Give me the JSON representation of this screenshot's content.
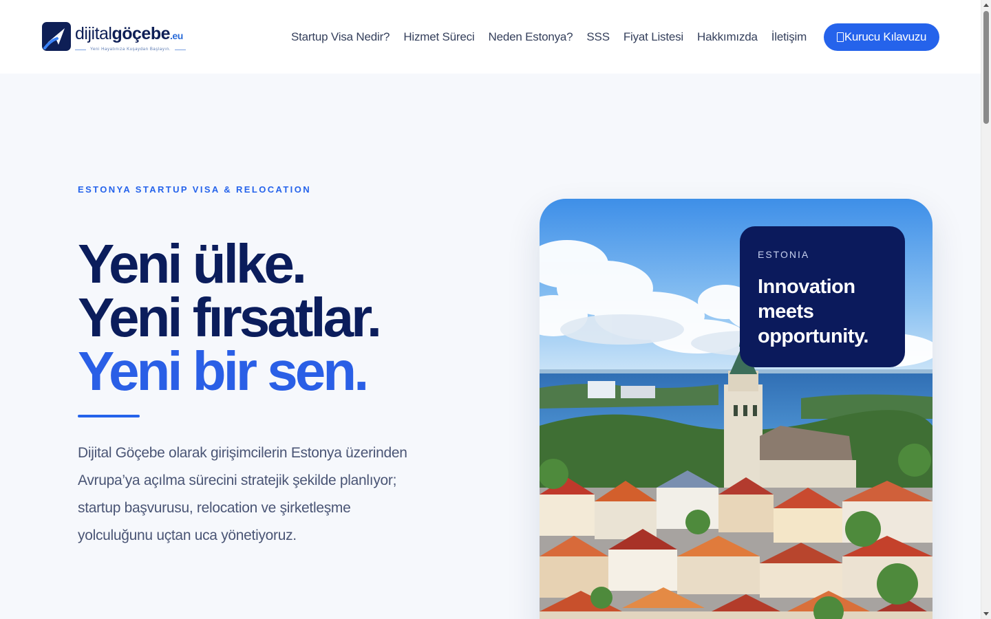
{
  "header": {
    "logo": {
      "word_regular": "dijital",
      "word_bold": "göçebe",
      "word_tld": ".eu",
      "tagline": "Yeni Hayatınıza Kuşaydan Başlayın."
    },
    "nav": [
      {
        "label": "Startup Visa Nedir?"
      },
      {
        "label": "Hizmet Süreci"
      },
      {
        "label": "Neden Estonya?"
      },
      {
        "label": "SSS"
      },
      {
        "label": "Fiyat Listesi"
      },
      {
        "label": "Hakkımızda"
      },
      {
        "label": "İletişim"
      }
    ],
    "cta": {
      "label": "Kurucu Kılavuzu",
      "icon": "book-icon"
    }
  },
  "hero": {
    "eyebrow": "ESTONYA STARTUP VISA & RELOCATION",
    "headline": [
      "Yeni ülke.",
      "Yeni fırsatlar.",
      "Yeni bir sen."
    ],
    "description": "Dijital Göçebe olarak girişimcilerin Estonya üzerinden Avrupa’ya açılma sürecini stratejik şekilde planlıyor; startup başvurusu, relocation ve şirketleşme yolculuğunu uçtan uca yönetiyoruz."
  },
  "photo_badge": {
    "eyebrow": "ESTONIA",
    "title": "Innovation meets opportunity."
  },
  "colors": {
    "primary": "#2563eb",
    "navy": "#0b1d5c",
    "badge_bg": "#0b1a5c",
    "page_bg": "#f6f8fc"
  }
}
